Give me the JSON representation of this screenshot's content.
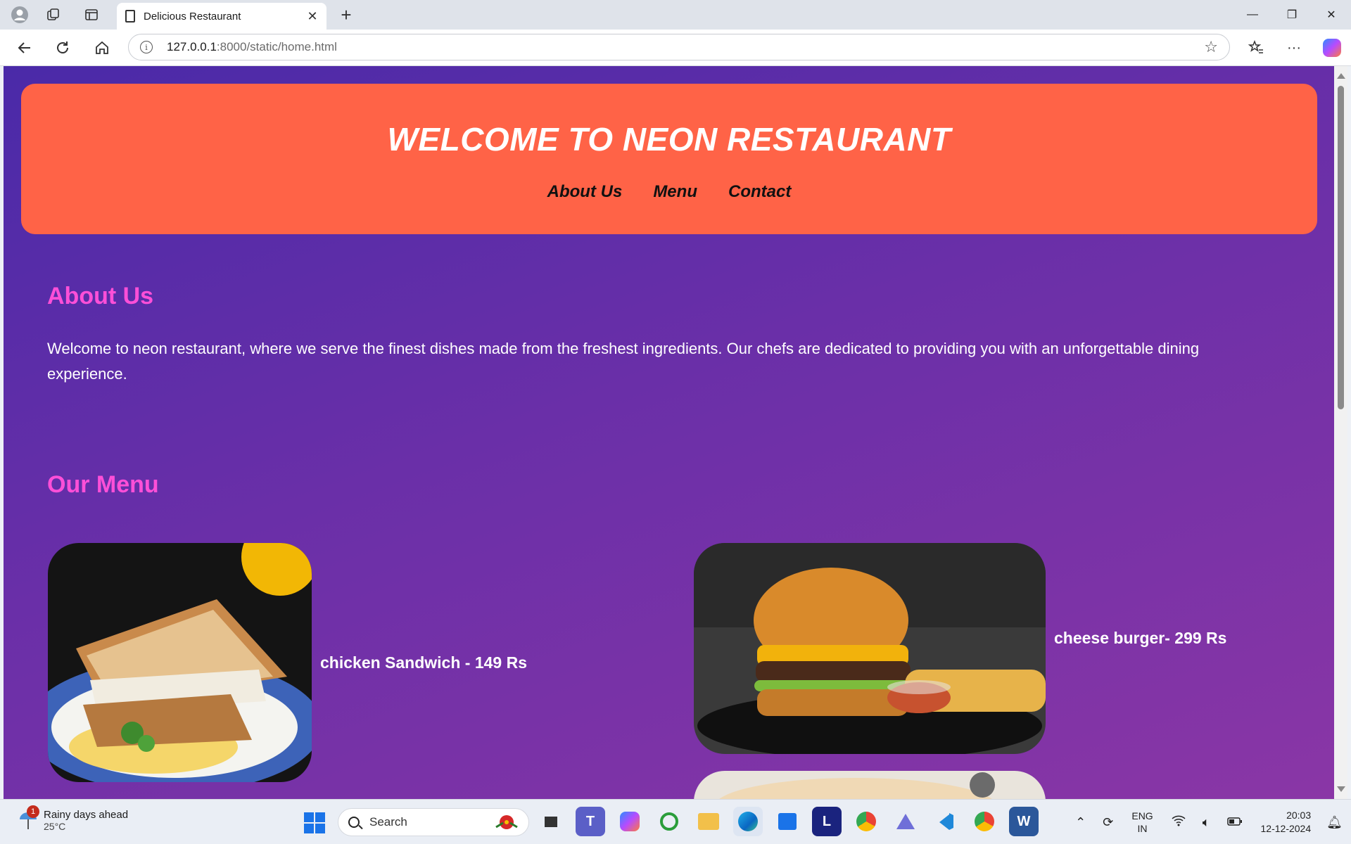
{
  "browser": {
    "tab_title": "Delicious Restaurant",
    "url_host": "127.0.0.1",
    "url_path": ":8000/static/home.html"
  },
  "header": {
    "title": "WELCOME TO NEON RESTAURANT",
    "nav": [
      "About Us",
      "Menu",
      "Contact"
    ]
  },
  "about": {
    "title": "About Us",
    "text": "Welcome to neon restaurant, where we serve the finest dishes made from the freshest ingredients. Our chefs are dedicated to providing you with an unforgettable dining experience."
  },
  "menu": {
    "title": "Our Menu",
    "items": [
      {
        "label": "chicken Sandwich - 149 Rs"
      },
      {
        "label": "cheese burger- 299 Rs"
      }
    ]
  },
  "taskbar": {
    "weather_title": "Rainy days ahead",
    "weather_temp": "25°C",
    "weather_badge": "1",
    "search_placeholder": "Search",
    "lang_line1": "ENG",
    "lang_line2": "IN",
    "time": "20:03",
    "date": "12-12-2024"
  },
  "colors": {
    "header_bg": "#ff6347",
    "accent_pink": "#ff4fd8",
    "page_bg_start": "#4a2aa8",
    "page_bg_end": "#8a36a6"
  }
}
